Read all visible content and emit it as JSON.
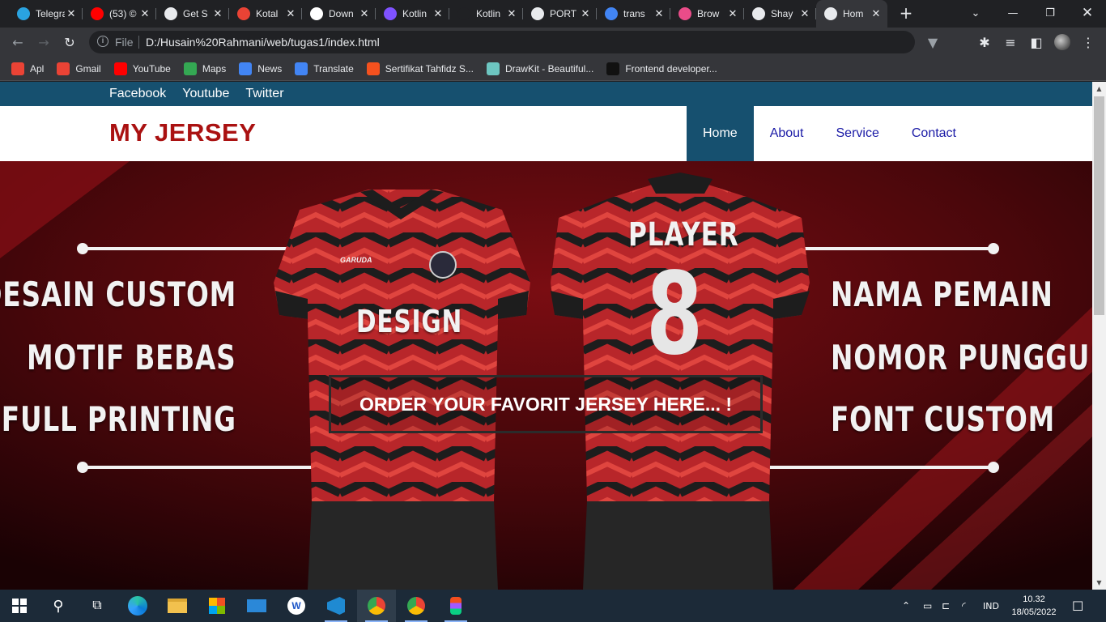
{
  "browser": {
    "tabs": [
      {
        "title": "Telegram",
        "icon": "telegram-icon",
        "color": "#2aa3e0"
      },
      {
        "title": "(53) ©",
        "icon": "youtube-icon",
        "color": "#ff0000"
      },
      {
        "title": "Get S",
        "icon": "globe-icon",
        "color": "#e8eaed"
      },
      {
        "title": "Kotal",
        "icon": "gmail-icon",
        "color": "#ea4335"
      },
      {
        "title": "Down",
        "icon": "record-icon",
        "color": "#ffffff"
      },
      {
        "title": "Kotlin",
        "icon": "kotlin-icon",
        "color": "#7f52ff"
      },
      {
        "title": "Kotlin",
        "icon": "blank-icon",
        "color": "#202124"
      },
      {
        "title": "PORT",
        "icon": "globe-icon",
        "color": "#e8eaed"
      },
      {
        "title": "trans",
        "icon": "google-icon",
        "color": "#4285f4"
      },
      {
        "title": "Brow",
        "icon": "dribbble-icon",
        "color": "#ea4c89"
      },
      {
        "title": "Shay",
        "icon": "globe-icon",
        "color": "#e8eaed"
      },
      {
        "title": "Hom",
        "icon": "page-icon",
        "color": "#e8eaed"
      }
    ],
    "active_tab_index": 11,
    "address": {
      "scheme": "File",
      "url": "D:/Husain%20Rahmani/web/tugas1/index.html"
    },
    "bookmarks": [
      {
        "label": "Apl",
        "icon": "apps-grid-icon",
        "color": "#ea4335"
      },
      {
        "label": "Gmail",
        "icon": "gmail-icon",
        "color": "#ea4335"
      },
      {
        "label": "YouTube",
        "icon": "youtube-icon",
        "color": "#ff0000"
      },
      {
        "label": "Maps",
        "icon": "maps-icon",
        "color": "#34a853"
      },
      {
        "label": "News",
        "icon": "news-icon",
        "color": "#4285f4"
      },
      {
        "label": "Translate",
        "icon": "translate-icon",
        "color": "#4285f4"
      },
      {
        "label": "Sertifikat Tahfidz S...",
        "icon": "certificate-icon",
        "color": "#f4511e"
      },
      {
        "label": "DrawKit - Beautiful...",
        "icon": "drawkit-icon",
        "color": "#6dc6c1"
      },
      {
        "label": "Frontend developer...",
        "icon": "dt-icon",
        "color": "#111111"
      }
    ]
  },
  "page": {
    "social_links": [
      "Facebook",
      "Youtube",
      "Twitter"
    ],
    "logo": "MY JERSEY",
    "nav": [
      "Home",
      "About",
      "Service",
      "Contact"
    ],
    "nav_active": "Home",
    "hero": {
      "left_features": [
        "DESAIN CUSTOM",
        "MOTIF BEBAS",
        "FULL PRINTING"
      ],
      "right_features": [
        "NAMA PEMAIN",
        "NOMOR PUNGGUNG",
        "FONT CUSTOM"
      ],
      "jersey_front_text": "DESIGN",
      "jersey_brand": "GARUDA",
      "jersey_back_name": "PLAYER",
      "jersey_back_number": "8",
      "cta": "ORDER YOUR FAVORIT JERSEY HERE... !"
    },
    "colors": {
      "topbar": "#16506f",
      "logo": "#aa1111",
      "nav_link": "#1a1aa6",
      "hero_bg": "#5a0a0e",
      "jersey_red": "#c62a2a"
    }
  },
  "taskbar": {
    "language": "IND",
    "time": "10.32",
    "date": "18/05/2022"
  }
}
